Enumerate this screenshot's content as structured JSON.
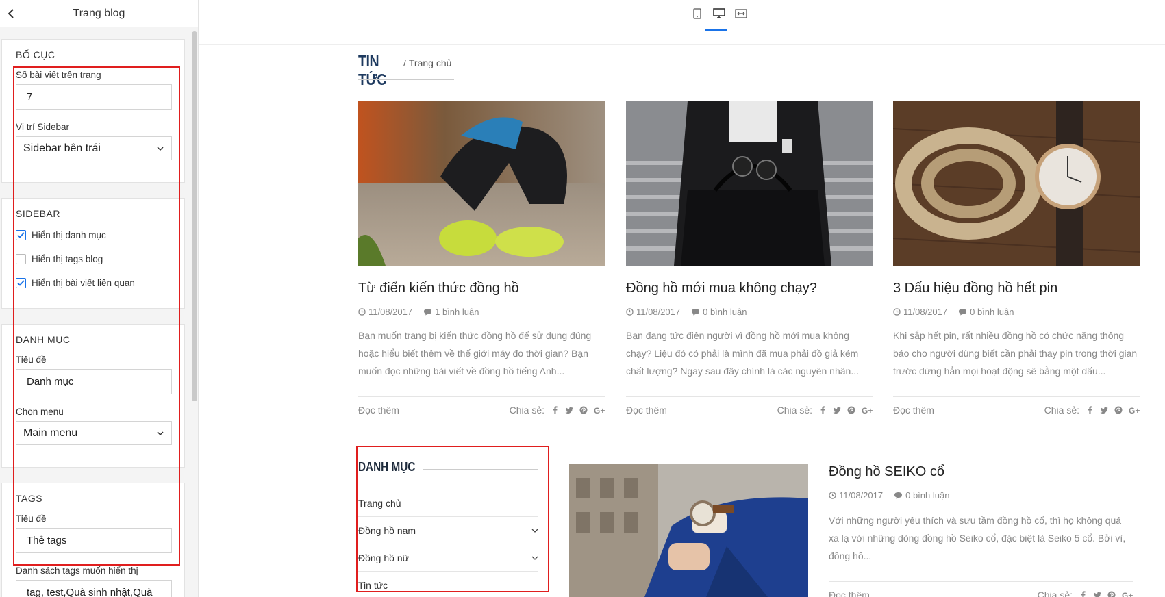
{
  "panel": {
    "title": "Trang blog",
    "layout": {
      "title": "BỐ CỤC",
      "posts_per_page_label": "Số bài viết trên trang",
      "posts_per_page_value": "7",
      "sidebar_position_label": "Vị trí Sidebar",
      "sidebar_position_value": "Sidebar bên trái"
    },
    "sidebar": {
      "title": "SIDEBAR",
      "options": [
        {
          "label": "Hiển thị danh mục",
          "checked": true
        },
        {
          "label": "Hiển thị tags blog",
          "checked": false
        },
        {
          "label": "Hiển thị bài viết liên quan",
          "checked": true
        }
      ]
    },
    "category": {
      "title": "DANH MỤC",
      "title_label": "Tiêu đề",
      "title_value": "Danh mục",
      "menu_label": "Chọn menu",
      "menu_value": "Main menu"
    },
    "tags": {
      "title": "TAGS",
      "title_label": "Tiêu đề",
      "title_value": "Thẻ tags",
      "list_label": "Danh sách tags muốn hiển thị",
      "list_value": "tag, test,Quà sinh nhật,Quà"
    }
  },
  "preview": {
    "breadcrumb": {
      "title": "TIN TỨC",
      "separator": "/",
      "home": "Trang chủ"
    },
    "read_more": "Đọc thêm",
    "share_label": "Chia sẻ:",
    "posts": [
      {
        "title": "Từ điển kiến thức đồng hồ",
        "date": "11/08/2017",
        "comments": "1 bình luận",
        "excerpt": "Bạn muốn trang bị kiến thức đồng hồ để sử dụng đúng hoặc hiểu biết thêm về thế giới máy đo thời gian? Bạn muốn đọc những bài viết về đồng hồ tiếng Anh..."
      },
      {
        "title": "Đồng hồ mới mua không chạy?",
        "date": "11/08/2017",
        "comments": "0 bình luận",
        "excerpt": "Bạn đang tức điên người vì đồng hồ mới mua không chạy? Liệu đó có phải là mình đã mua phải đồ giả kém chất lượng? Ngay sau đây chính là các nguyên nhân..."
      },
      {
        "title": "3 Dấu hiệu đồng hồ hết pin",
        "date": "11/08/2017",
        "comments": "0 bình luận",
        "excerpt": "Khi sắp hết pin, rất nhiều đồng hồ có chức năng thông báo cho người dùng biết cần phải thay pin trong thời gian trước dừng hẳn mọi hoạt động sẽ bằng một dấu..."
      },
      {
        "title": "Đồng hồ SEIKO cổ",
        "date": "11/08/2017",
        "comments": "0 bình luận",
        "excerpt": "Với những người yêu thích và sưu tầm đồng hồ cổ, thì họ không quá xa lạ với những dòng đồng hồ Seiko cổ, đặc biệt là Seiko 5 cổ. Bởi vì, đồng hồ..."
      }
    ],
    "widget": {
      "title": "DANH MỤC",
      "items": [
        "Trang chủ",
        "Đồng hồ nam",
        "Đồng hồ nữ",
        "Tin tức"
      ]
    }
  },
  "colors": {
    "accent": "#1a73e8",
    "highlight": "#e01e1e",
    "breadcrumb": "#1e3a5f"
  }
}
